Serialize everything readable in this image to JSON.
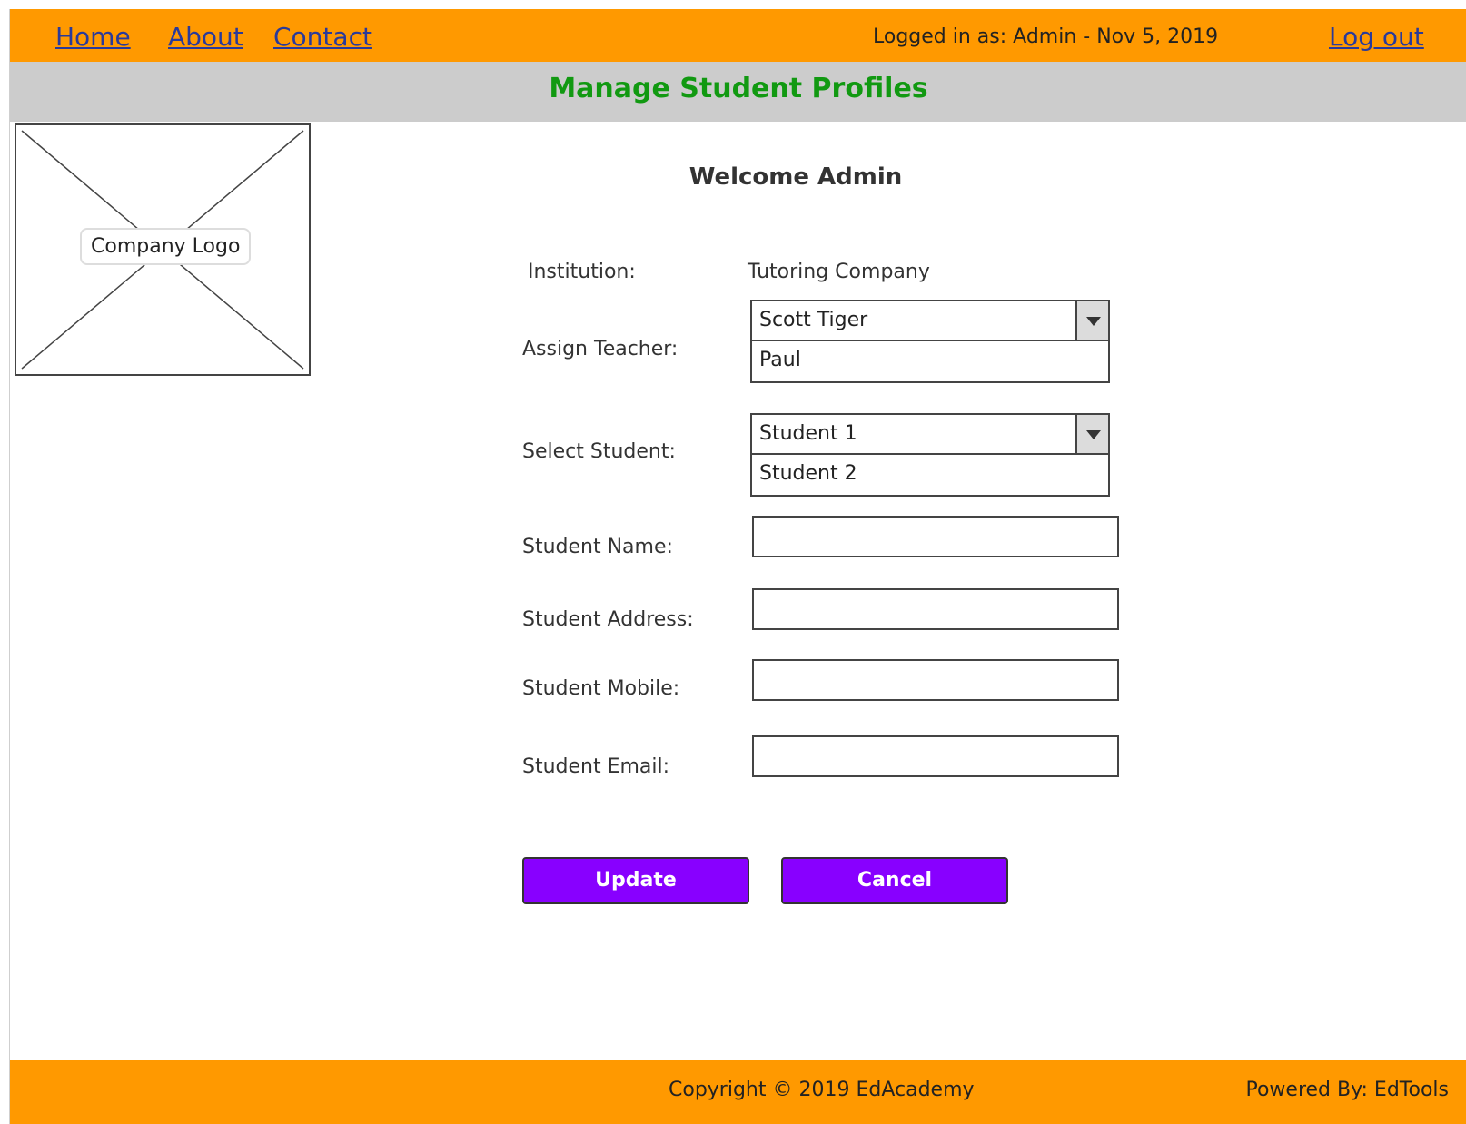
{
  "nav": {
    "home": "Home",
    "about": "About",
    "contact": "Contact",
    "logged_in": "Logged in as: Admin - Nov 5, 2019",
    "logout": "Log out"
  },
  "page_title": "Manage Student Profiles",
  "logo": {
    "label": "Company Logo",
    "icon": "image-placeholder-icon"
  },
  "welcome": "Welcome Admin",
  "form": {
    "institution_label": "Institution:",
    "institution_value": "Tutoring Company",
    "teacher_label": "Assign Teacher:",
    "teacher_selected": "Scott Tiger",
    "teacher_option": "Paul",
    "student_label": "Select Student:",
    "student_selected": "Student 1",
    "student_option": "Student 2",
    "name_label": "Student Name:",
    "address_label": "Student Address:",
    "mobile_label": "Student Mobile:",
    "email_label": "Student Email:",
    "name_value": "",
    "address_value": "",
    "mobile_value": "",
    "email_value": ""
  },
  "buttons": {
    "update": "Update",
    "cancel": "Cancel"
  },
  "footer": {
    "copyright": "Copyright © 2019 EdAcademy",
    "powered": "Powered By: EdTools"
  },
  "colors": {
    "header_orange": "#FF9900",
    "title_green": "#119911",
    "button_purple": "#8800FF",
    "band_gray": "#CCCCCC"
  }
}
